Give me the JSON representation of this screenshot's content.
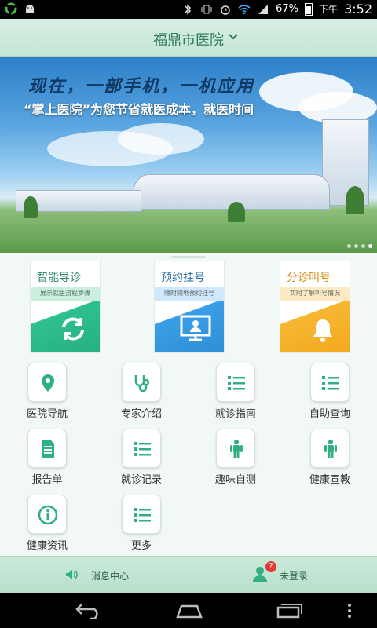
{
  "statusbar": {
    "battery": "67%",
    "ampm": "下午",
    "time": "3:52"
  },
  "header": {
    "title": "福鼎市医院"
  },
  "banner": {
    "slogan_main": "现在，一部手机，一机应用",
    "slogan_sub": "“掌上医院”为您节省就医成本，就医时间"
  },
  "cards": [
    {
      "title": "智能导诊",
      "subtitle": "展示就医流程步骤",
      "color": "#2fc08f",
      "title_color": "#2f8a66"
    },
    {
      "title": "预约挂号",
      "subtitle": "随时随地预约挂号",
      "color": "#3a9ee6",
      "title_color": "#2b6ea3"
    },
    {
      "title": "分诊叫号",
      "subtitle": "实时了解叫号情况",
      "color": "#f7b733",
      "title_color": "#d48c12"
    }
  ],
  "grid": [
    {
      "label": "医院导航",
      "icon": "location-pin-icon"
    },
    {
      "label": "专家介绍",
      "icon": "stethoscope-icon"
    },
    {
      "label": "就诊指南",
      "icon": "list-icon"
    },
    {
      "label": "自助查询",
      "icon": "list-icon"
    },
    {
      "label": "报告单",
      "icon": "document-icon"
    },
    {
      "label": "就诊记录",
      "icon": "list-icon"
    },
    {
      "label": "趣味自测",
      "icon": "human-body-icon"
    },
    {
      "label": "健康宣教",
      "icon": "human-body-icon"
    },
    {
      "label": "健康资讯",
      "icon": "info-icon"
    },
    {
      "label": "更多",
      "icon": "list-icon"
    }
  ],
  "bottom": {
    "messages": "消息中心",
    "login": "未登录",
    "login_badge": "?"
  },
  "colors": {
    "accent": "#2fb07e",
    "header_bg": "#c9e9da"
  }
}
